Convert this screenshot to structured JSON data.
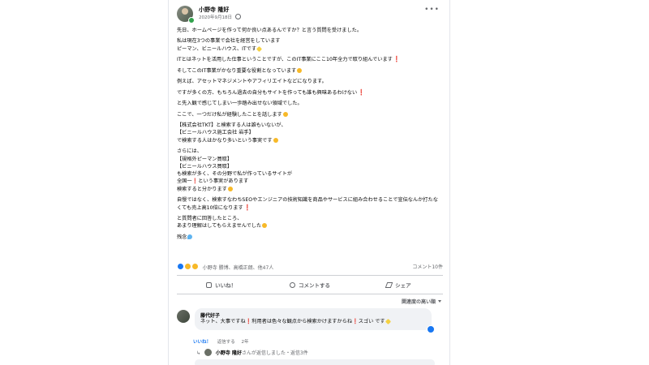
{
  "post": {
    "author": "小野寺 隆好",
    "date": "2020年9月18日",
    "more_icon": "more-horizontal-icon",
    "paragraphs": [
      {
        "text": "先日、ホームページを作って何か良い点あるんですか？と言う質問を受けました。",
        "emoji": ""
      },
      {
        "text": "私は現在3つの事業で会社を経営をしています\nピーマン、ビニールハウス、ITです",
        "emoji": ""
      },
      {
        "text": "ITとはネットを活用した仕事ということですが、このIT事業にここ10年全力で取り組んでいます",
        "emoji": "❗"
      },
      {
        "text": "そしてこのIT事業がかなり重要な役割となっています",
        "emoji": ""
      },
      {
        "text": "例えば、アセットマネジメントやアフィリエイトなどになります。",
        "emoji": ""
      },
      {
        "text": "ですが多くの方、もちろん過去の自分もサイトを作っても誰も興味あるわけない",
        "emoji": "❗"
      },
      {
        "text": "と先入観で感じてしまい一歩踏み出せない領域でした。",
        "emoji": ""
      },
      {
        "text": "ここで、一つだけ私が経験したことを話します",
        "emoji": ""
      },
      {
        "text": "【株式会社TKT】と検索する人は誰もいないが、\n【ビニールハウス施工会社 岩手】\nで検索する人はかなり多いという事実です",
        "emoji": ""
      },
      {
        "text": "さらには、\n【規格外ピーマン買取】\n【ビニールハウス買取】\nも検索が多く、その分野で私が作っているサイトが\n全国一❗️という事実があります\n検索すると分かります",
        "emoji": ""
      },
      {
        "text": "自慢ではなく、検索すなわちSEOやエンジニアの技術知識を商品やサービスに組み合わせることで宣伝なんか打たなくても売上高10倍になります",
        "emoji": "❗"
      },
      {
        "text": "と質問者に回答したところ、\nあまり理解はしてもらえませんでした",
        "emoji": ""
      },
      {
        "text": "残念",
        "emoji": ""
      }
    ]
  },
  "reactions": {
    "names": "小野寺 勝博、高橋正朗、他47人",
    "comment_count": "コメント10件"
  },
  "actions": {
    "like": "いいね！",
    "comment": "コメントする",
    "share": "シェア"
  },
  "sort_label": "関連度の高い順",
  "comment": {
    "name": "藤代好子",
    "text": "ネット、大事ですね❗️利用者は色々な観点から検索かけますからね❗️スゴい です",
    "like": "いいね！",
    "reply": "返信する",
    "age": "2年"
  },
  "reply_summary": {
    "name": "小野寺 隆好",
    "text": "さんが返信しました・返信3件"
  },
  "colors": {
    "accent": "#1877f2",
    "text_secondary": "#65676b",
    "bubble_bg": "#f0f2f5"
  }
}
